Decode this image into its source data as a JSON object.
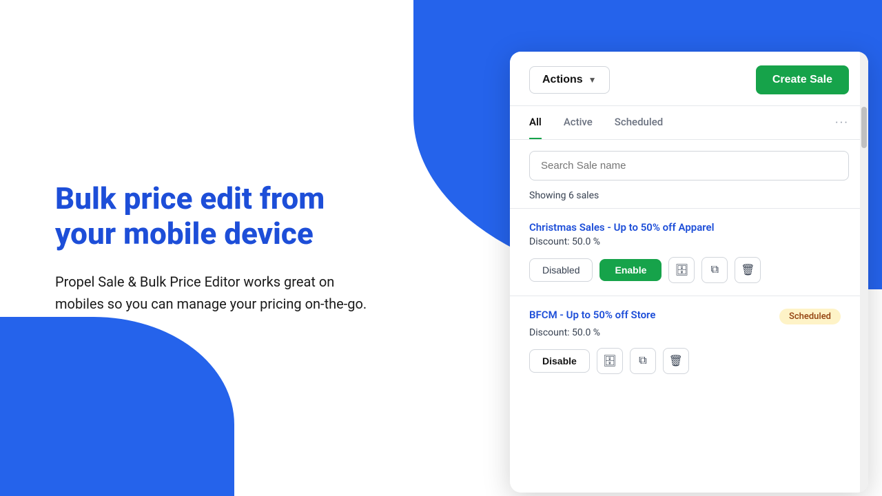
{
  "background": {
    "blob_color": "#2563eb"
  },
  "left": {
    "title": "Bulk price edit from your mobile device",
    "description": "Propel Sale & Bulk Price Editor works great on mobiles so you can manage your pricing on-the-go."
  },
  "panel": {
    "header": {
      "actions_label": "Actions",
      "create_sale_label": "Create Sale"
    },
    "tabs": [
      {
        "label": "All",
        "active": true
      },
      {
        "label": "Active",
        "active": false
      },
      {
        "label": "Scheduled",
        "active": false
      }
    ],
    "tab_more": "···",
    "search_placeholder": "Search Sale name",
    "showing_text": "Showing 6 sales",
    "sales": [
      {
        "name": "Christmas Sales - Up to 50% off Apparel",
        "discount": "Discount: 50.0 %",
        "status": "disabled",
        "badge": null,
        "btn_left_label": "Disabled",
        "btn_right_label": "Enable"
      },
      {
        "name": "BFCM - Up to 50% off Store",
        "discount": "Discount: 50.0 %",
        "status": "scheduled",
        "badge": "Scheduled",
        "btn_left_label": "Disable",
        "btn_right_label": null
      }
    ]
  },
  "icons": {
    "archive": "🗄",
    "copy": "⧉",
    "trash": "🗑",
    "chevron_down": "▼"
  }
}
